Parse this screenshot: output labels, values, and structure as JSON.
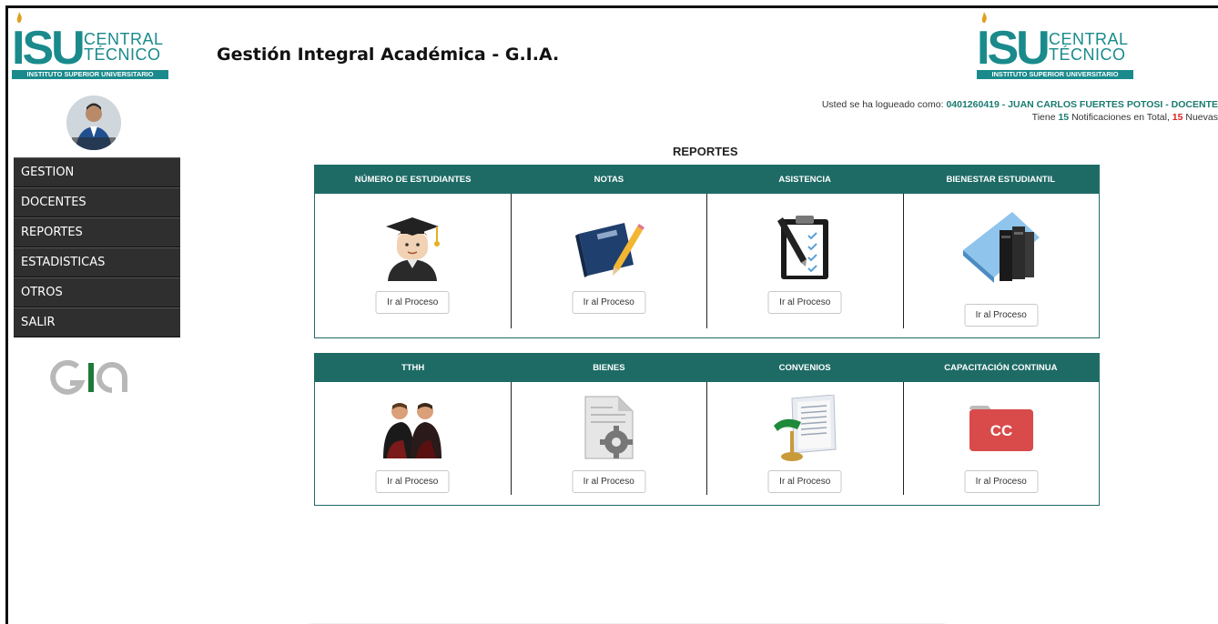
{
  "header": {
    "logo_left": {
      "main": "ISU",
      "sub_line1": "CENTRAL",
      "sub_line2": "TÉCNICO",
      "bar": "INSTITUTO SUPERIOR UNIVERSITARIO"
    },
    "logo_right": {
      "main": "ISU",
      "sub_line1": "CENTRAL",
      "sub_line2": "TÉCNICO",
      "bar": "INSTITUTO SUPERIOR UNIVERSITARIO"
    },
    "app_title": "Gestión Integral Académica - G.I.A.",
    "login_prefix": "Usted se ha logueado como: ",
    "login_user": "0401260419 - JUAN CARLOS FUERTES POTOSI - DOCENTE",
    "notif_prefix": "Tiene ",
    "notif_total": "15",
    "notif_middle": " Notificaciones en Total, ",
    "notif_new": "15",
    "notif_suffix": " Nuevas"
  },
  "sidebar": {
    "items": [
      {
        "label": "GESTION"
      },
      {
        "label": "DOCENTES"
      },
      {
        "label": "REPORTES"
      },
      {
        "label": "ESTADISTICAS"
      },
      {
        "label": "OTROS"
      },
      {
        "label": "SALIR"
      }
    ],
    "footer_logo": "GIA"
  },
  "main": {
    "section_title": "REPORTES",
    "panel1": [
      {
        "title": "NÚMERO DE ESTUDIANTES",
        "icon": "graduate-icon",
        "button": "Ir al Proceso"
      },
      {
        "title": "NOTAS",
        "icon": "notebook-pencil-icon",
        "button": "Ir al Proceso"
      },
      {
        "title": "ASISTENCIA",
        "icon": "clipboard-checklist-icon",
        "button": "Ir al Proceso"
      },
      {
        "title": "BIENESTAR ESTUDIANTIL",
        "icon": "books-icon",
        "button": "Ir al Proceso"
      }
    ],
    "panel2": [
      {
        "title": "TTHH",
        "icon": "people-icon",
        "button": "Ir al Proceso"
      },
      {
        "title": "BIENES",
        "icon": "document-gear-icon",
        "button": "Ir al Proceso"
      },
      {
        "title": "CONVENIOS",
        "icon": "desk-lamp-documents-icon",
        "button": "Ir al Proceso"
      },
      {
        "title": "CAPACITACIÓN CONTINUA",
        "icon": "cc-folder-icon",
        "icon_text": "CC",
        "button": "Ir al Proceso"
      }
    ]
  },
  "colors": {
    "brand": "#1a8a8c",
    "panel_header": "#1e6b66",
    "menu_bg": "#2f2f2f",
    "alert": "#e02020"
  }
}
